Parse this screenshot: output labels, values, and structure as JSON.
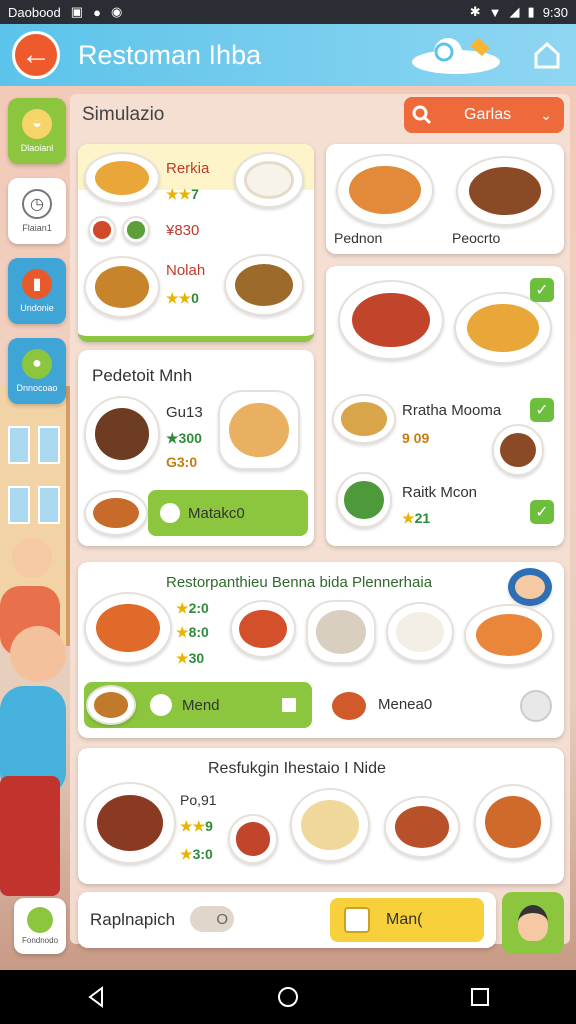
{
  "status_bar": {
    "carrier": "Daobood",
    "time": "9:30"
  },
  "app_bar": {
    "title": "Restoman Ihba"
  },
  "sidebar": {
    "items": [
      {
        "label": "Dlaoianl",
        "icon": "drink-icon"
      },
      {
        "label": "Flaian1",
        "icon": "clock-icon"
      },
      {
        "label": "Undonie",
        "icon": "cup-icon"
      },
      {
        "label": "Dnnocoao",
        "icon": "leaf-icon"
      }
    ],
    "bottom": {
      "label": "Fondnodo",
      "icon": "leaf-icon"
    }
  },
  "panel": {
    "title": "Simulazio",
    "search_label": "Garlas"
  },
  "card1": {
    "item1_name": "Rerkia",
    "item1_rating": "7",
    "item2_price": "¥830",
    "item3_name": "Nolah",
    "item3_rating": "0"
  },
  "card2": {
    "left_label": "Pednon",
    "right_label": "Peocrto"
  },
  "card3": {
    "title": "Pedetoit Mnh",
    "line1": "Gu13",
    "line2": "★300",
    "line3": "G3:0",
    "button_label": "Matakc0"
  },
  "card4": {
    "item1_name": "Rratha Mooma",
    "item1_price": "9 09",
    "item2_name": "Raitk Mcon",
    "item2_rating": "21"
  },
  "card5": {
    "title": "Restorpanthieu Benna bida Plennerhaia",
    "rating1": "2:0",
    "rating2": "8:0",
    "rating3": "30",
    "menu1": "Mend",
    "menu2": "Menea0"
  },
  "card6": {
    "title": "Resfukgin Ihestaio I Nide",
    "price": "Po,91",
    "rating1": "9",
    "rating2": "3:0"
  },
  "bottom_bar": {
    "label": "Raplnapich",
    "toggle": "O",
    "button_label": "Man("
  },
  "colors": {
    "accent_orange": "#ef5a2c",
    "appbar_blue": "#5cc3ea",
    "green": "#8cc63f",
    "yellow": "#f7d03b"
  }
}
